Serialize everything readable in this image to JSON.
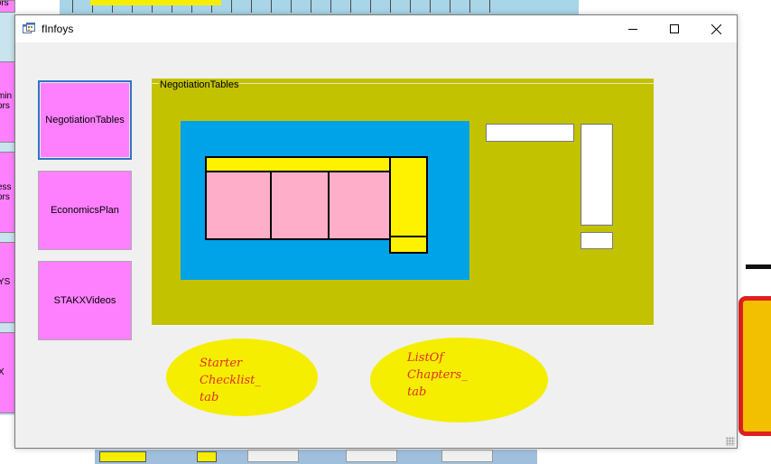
{
  "window": {
    "title": "fInfoys"
  },
  "title_controls": {
    "minimize": "minimize",
    "maximize": "maximize",
    "close": "close"
  },
  "nav_buttons": [
    {
      "label": "NegotiationTables",
      "active": true
    },
    {
      "label": "EconomicsPlan",
      "active": false
    },
    {
      "label": "STAKXVideos",
      "active": false
    }
  ],
  "group": {
    "title": "NegotiationTables"
  },
  "ovals": [
    {
      "text": "Starter\nChecklist_\ntab"
    },
    {
      "text": "ListOf\nChapters_\ntab"
    }
  ],
  "background_window": {
    "left_buttons": [
      "idors",
      "min\nors",
      "ess\nors",
      "YS",
      "X"
    ]
  },
  "colors": {
    "nav_button": "#ff80ff",
    "group_background": "#c3c200",
    "panel_blue": "#00a2e8",
    "table_yellow": "#fff200",
    "table_pink": "#ffaec9",
    "oval_yellow": "#f6ee00",
    "oval_text": "#e0301e",
    "window_background": "#f0f0f0"
  },
  "icons": {
    "app": "app-window-icon"
  }
}
